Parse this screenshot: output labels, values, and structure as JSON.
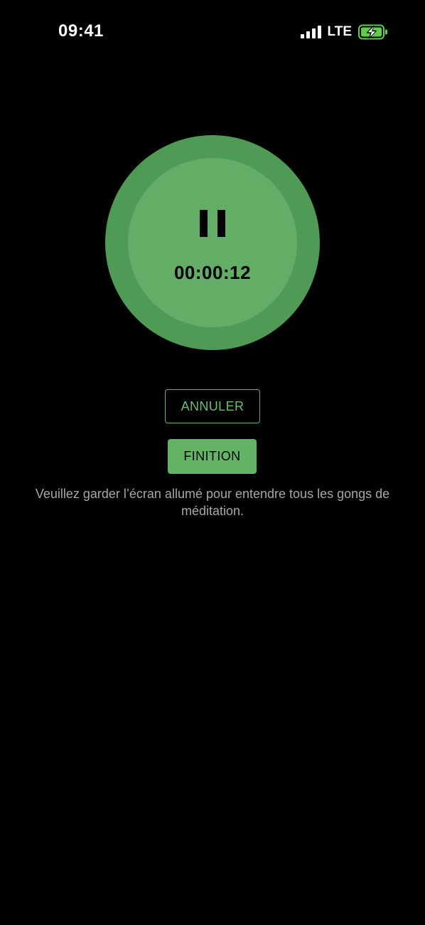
{
  "status_bar": {
    "time": "09:41",
    "network": "LTE",
    "signal_icon": "cellular-signal-icon",
    "battery_icon": "battery-charging-icon",
    "battery_color": "#5fce4c"
  },
  "timer": {
    "pause_icon": "pause-icon",
    "elapsed": "00:00:12",
    "outer_color": "#4f9a54",
    "inner_color": "#63ad67"
  },
  "actions": {
    "cancel_label": "ANNULER",
    "finish_label": "FINITION",
    "accent_color": "#63b565"
  },
  "info": {
    "message": "Veuillez garder l’écran allumé pour entendre tous les gongs de méditation."
  }
}
